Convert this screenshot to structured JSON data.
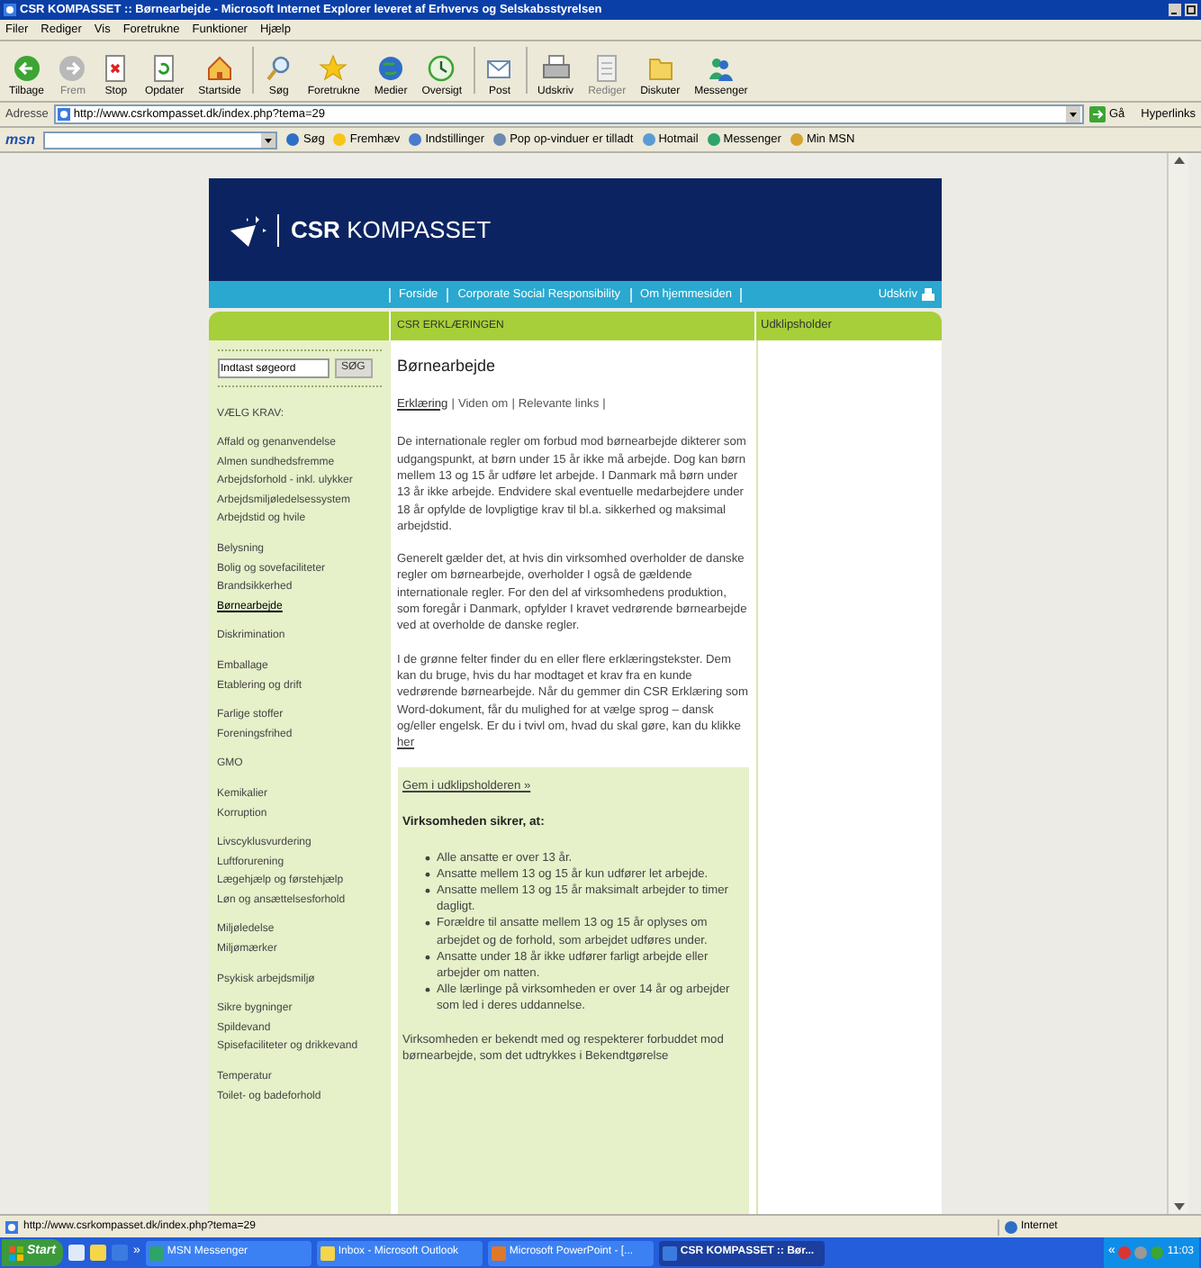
{
  "window": {
    "title": "CSR KOMPASSET :: Børnearbejde - Microsoft Internet Explorer leveret af Erhvervs og Selskabsstyrelsen"
  },
  "menu": [
    "Filer",
    "Rediger",
    "Vis",
    "Foretrukne",
    "Funktioner",
    "Hjælp"
  ],
  "toolbar": [
    {
      "label": "Tilbage",
      "disabled": false
    },
    {
      "label": "Frem",
      "disabled": true
    },
    {
      "label": "Stop",
      "disabled": false
    },
    {
      "label": "Opdater",
      "disabled": false
    },
    {
      "label": "Startside",
      "disabled": false
    },
    {
      "label": "Søg",
      "disabled": false
    },
    {
      "label": "Foretrukne",
      "disabled": false
    },
    {
      "label": "Medier",
      "disabled": false
    },
    {
      "label": "Oversigt",
      "disabled": false
    },
    {
      "label": "Post",
      "disabled": false
    },
    {
      "label": "Udskriv",
      "disabled": false
    },
    {
      "label": "Rediger",
      "disabled": true
    },
    {
      "label": "Diskuter",
      "disabled": false
    },
    {
      "label": "Messenger",
      "disabled": false
    }
  ],
  "address": {
    "label": "Adresse",
    "url": "http://www.csrkompasset.dk/index.php?tema=29",
    "go": "Gå",
    "links": "Hyperlinks"
  },
  "msn_bar": {
    "logo": "msn",
    "items": [
      "Søg",
      "Fremhæv",
      "Indstillinger",
      "Pop op-vinduer er tilladt",
      "Hotmail",
      "Messenger",
      "Min MSN"
    ]
  },
  "site": {
    "title": "**CSR** KOMPASSET",
    "nav": [
      "Forside",
      "Corporate Social Responsibility",
      "Om hjemmesiden"
    ],
    "print": "Udskriv",
    "headers": [
      "CSR ERKLÆRINGEN",
      "Udklipsholder"
    ],
    "search": {
      "placeholder": "Indtast søgeord",
      "button": "SØG"
    },
    "requirements_heading": "VÆLG KRAV:",
    "requirement_groups": [
      [
        {
          "label": "Affald og genanvendelse",
          "selected": false
        },
        {
          "label": "Almen sundhedsfremme",
          "selected": false
        },
        {
          "label": "Arbejdsforhold - inkl. ulykker",
          "selected": false
        },
        {
          "label": "Arbejdsmiljøledelsessystem",
          "selected": false
        },
        {
          "label": "Arbejdstid og hvile",
          "selected": false
        }
      ],
      [
        {
          "label": "Belysning",
          "selected": false
        },
        {
          "label": "Bolig og sovefaciliteter",
          "selected": false
        },
        {
          "label": "Brandsikkerhed",
          "selected": false
        },
        {
          "label": "Børnearbejde",
          "selected": true
        }
      ],
      [
        {
          "label": "Diskrimination",
          "selected": false
        }
      ],
      [
        {
          "label": "Emballage",
          "selected": false
        },
        {
          "label": "Etablering og drift",
          "selected": false
        }
      ],
      [
        {
          "label": "Farlige stoffer",
          "selected": false
        },
        {
          "label": "Foreningsfrihed",
          "selected": false
        }
      ],
      [
        {
          "label": "GMO",
          "selected": false
        }
      ],
      [
        {
          "label": "Kemikalier",
          "selected": false
        },
        {
          "label": "Korruption",
          "selected": false
        }
      ],
      [
        {
          "label": "Livscyklusvurdering",
          "selected": false
        },
        {
          "label": "Luftforurening",
          "selected": false
        },
        {
          "label": "Lægehjælp og førstehjælp",
          "selected": false
        },
        {
          "label": "Løn og ansættelsesforhold",
          "selected": false
        }
      ],
      [
        {
          "label": "Miljøledelse",
          "selected": false
        },
        {
          "label": "Miljømærker",
          "selected": false
        }
      ],
      [
        {
          "label": "Psykisk arbejdsmiljø",
          "selected": false
        }
      ],
      [
        {
          "label": "Sikre bygninger",
          "selected": false
        },
        {
          "label": "Spildevand",
          "selected": false
        },
        {
          "label": "Spisefaciliteter og drikkevand",
          "selected": false
        }
      ],
      [
        {
          "label": "Temperatur",
          "selected": false
        },
        {
          "label": "Toilet- og badeforhold",
          "selected": false
        }
      ]
    ],
    "page_title": "Børnearbejde",
    "tabs": [
      {
        "label": "Erklæring",
        "selected": true
      },
      {
        "label": "Viden om",
        "selected": false
      },
      {
        "label": "Relevante links",
        "selected": false
      }
    ],
    "tab_separator": "|",
    "paragraphs": [
      {
        "text": "De internationale regler om forbud mod børnearbejde dikterer som udgangspunkt, at børn under 15 år ikke må arbejde. Dog kan børn mellem 13 og 15 år udføre let arbejde. I Danmark må børn under 13 år ikke arbejde. Endvidere skal eventuelle medarbejdere under 18 år opfylde de lovpligtige krav til bl.a. sikkerhed og maksimal arbejdstid."
      },
      {
        "text": "Generelt gælder det, at hvis din virksomhed overholder de danske regler om børnearbejde, overholder I også de gældende internationale regler. For den del af virksomhedens produktion, som foregår i Danmark, opfylder I kravet vedrørende børnearbejde ved at overholde de danske regler."
      },
      {
        "text": "I de grønne felter finder du en eller flere erklæringstekster. Dem kan du bruge, hvis du har modtaget et krav fra en kunde vedrørende børnearbejde. Når du gemmer din CSR Erklæring som Word-dokument, får du mulighed for at vælge sprog – dansk og/eller engelsk. Er du i tvivl om, hvad du skal gøre, kan du klikke",
        "link": "her"
      }
    ],
    "declaration": {
      "save_link": "Gem i udklipsholderen »",
      "heading": "Virksomheden sikrer, at:",
      "bullets": [
        "Alle ansatte er over 13 år.",
        "Ansatte mellem 13 og 15 år kun udfører let arbejde.",
        "Ansatte mellem 13 og 15 år maksimalt arbejder to timer dagligt.",
        "Forældre til ansatte mellem 13 og 15 år oplyses om arbejdet og de forhold, som arbejdet udføres under.",
        "Ansatte under 18 år ikke udfører farligt arbejde eller arbejder om natten.",
        "Alle lærlinge på virksomheden er over 14 år og arbejder som led i deres uddannelse."
      ],
      "closing": "Virksomheden er bekendt med og respekterer forbuddet mod børnearbejde, som det udtrykkes i Bekendtgørelse"
    }
  },
  "status_bar": {
    "url": "http://www.csrkompasset.dk/index.php?tema=29",
    "zone": "Internet"
  },
  "taskbar": {
    "start": "Start",
    "more": "»",
    "tasks": [
      {
        "label": "MSN Messenger",
        "selected": false
      },
      {
        "label": "Inbox - Microsoft Outlook",
        "selected": false
      },
      {
        "label": "Microsoft PowerPoint - [...",
        "selected": false
      },
      {
        "label": "CSR KOMPASSET :: Bør...",
        "selected": true
      }
    ],
    "more_tray": "«",
    "time": "11:03"
  }
}
